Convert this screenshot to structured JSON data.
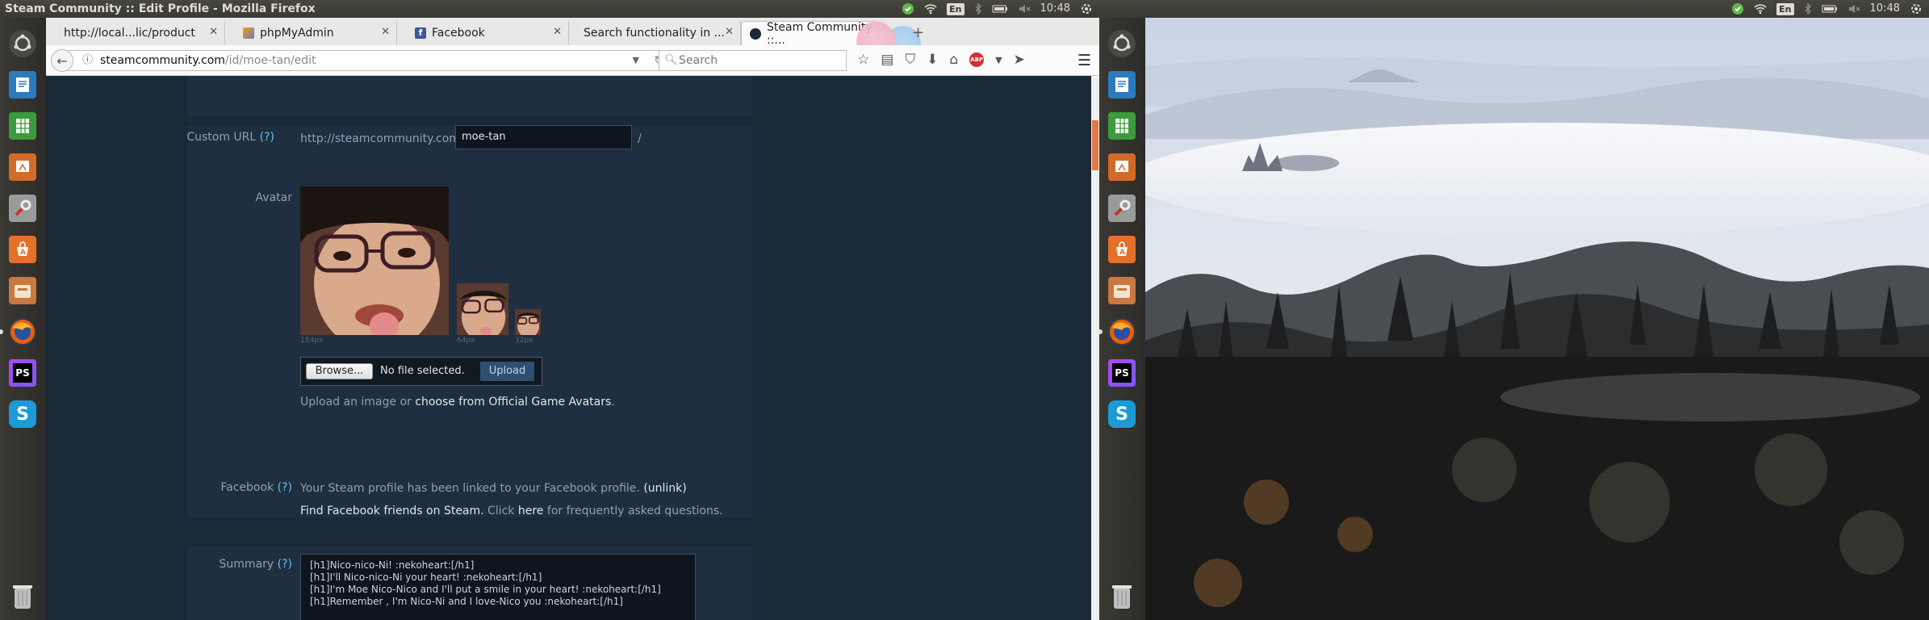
{
  "screen1": {
    "window_title": "Steam Community :: Edit Profile - Mozilla Firefox",
    "keyboard_layout": "En",
    "clock": "10:48"
  },
  "screen2": {
    "keyboard_layout": "En",
    "clock": "10:48"
  },
  "launcher": {
    "items": [
      "ubuntu-dash-icon",
      "libreoffice-writer-icon",
      "libreoffice-calc-icon",
      "libreoffice-impress-icon",
      "system-settings-icon",
      "ubuntu-software-center-icon",
      "file-manager-icon",
      "firefox-icon",
      "phpstorm-icon",
      "skype-icon"
    ],
    "phpstorm_label": "PS",
    "skype_label": "S"
  },
  "browser": {
    "tabs": [
      {
        "label": "http://local...lic/product",
        "icon": "blank-page-icon"
      },
      {
        "label": "phpMyAdmin",
        "icon": "phpmyadmin-icon"
      },
      {
        "label": "Facebook",
        "icon": "facebook-icon"
      },
      {
        "label": "Search functionality in ...",
        "icon": "blank-page-icon"
      },
      {
        "label": "Steam Community ::...",
        "icon": "steam-icon",
        "active": true
      }
    ],
    "url_host": "steamcommunity.com",
    "url_path": "/id/moe-tan/edit",
    "search_placeholder": "Search",
    "abp_label": "ABP"
  },
  "profile": {
    "custom_url_label": "Custom URL",
    "help": "(?)",
    "custom_url_prefix": "http://steamcommunity.com/id/",
    "custom_url_value": "moe-tan",
    "custom_url_suffix": "/",
    "avatar_label": "Avatar",
    "size_184": "184px",
    "size_64": "64px",
    "size_32": "32px",
    "browse_label": "Browse...",
    "no_file": "No file selected.",
    "upload_label": "Upload",
    "upload_hint_pre": "Upload an image or ",
    "upload_hint_link": "choose from Official Game Avatars",
    "upload_hint_post": ".",
    "facebook_label": "Facebook",
    "facebook_linked": "Your Steam profile has been linked to your Facebook profile. ",
    "facebook_unlink": "(unlink)",
    "facebook_find": "Find Facebook friends on Steam.",
    "facebook_click": " Click ",
    "facebook_here": "here",
    "facebook_faq": " for frequently asked questions.",
    "summary_label": "Summary",
    "summary_lines": [
      "[h1]Nico-nico-Ni! :nekoheart:[/h1]",
      "[h1]I'll Nico-nico-Ni your heart! :nekoheart:[/h1]",
      "[h1]I'm Moe Nico-Nico and I'll put a smile in your heart! :nekoheart:[/h1]",
      "[h1]Remember , I'm Nico-Ni and I love-Nico you :nekoheart:[/h1]"
    ]
  },
  "colors": {
    "steam_bg": "#1b2838",
    "steam_panel": "#1f2e40",
    "ubuntu_panel": "#3c3b37",
    "link_blue": "#66c0f4"
  }
}
